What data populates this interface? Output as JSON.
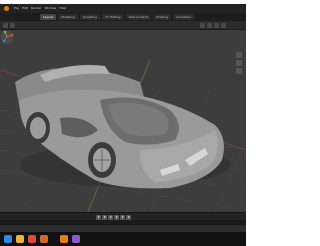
{
  "app": {
    "menus": [
      "File",
      "Edit",
      "Render",
      "Window",
      "Help"
    ],
    "workspace_tabs": [
      "Layout",
      "Modeling",
      "Sculpting",
      "UV Editing",
      "Texture Paint",
      "Shading",
      "Animation"
    ],
    "active_tab_index": 0
  },
  "timeline": {
    "play_controls": [
      "jump-start",
      "prev-keyframe",
      "play-reverse",
      "play",
      "next-keyframe",
      "jump-end"
    ]
  },
  "taskbar": {
    "icons": [
      "windows-start-icon",
      "file-explorer-icon",
      "chrome-icon",
      "photo-app-icon",
      "blender-icon",
      "media-icon"
    ],
    "icon_colors": [
      "#2a8de0",
      "#e9b33f",
      "#e04a3a",
      "#d06a2b",
      "#e87d0d",
      "#8a5ad0"
    ]
  },
  "colors": {
    "accent": "#e87d0d",
    "viewport_bg": "#3d3d3d",
    "car_body": "#8c8c8c"
  }
}
